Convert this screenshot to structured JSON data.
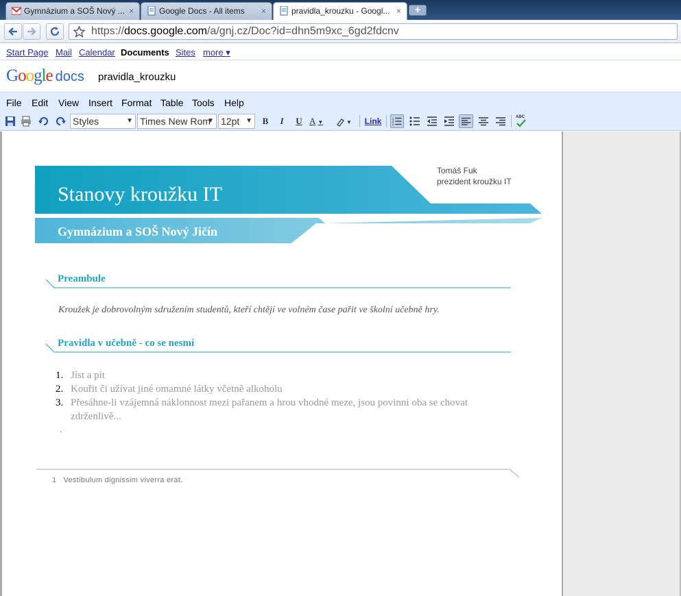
{
  "browser": {
    "tabs": [
      {
        "title": "Gymnázium a SOŠ Nový ...",
        "icon": "gmail-icon",
        "active": false
      },
      {
        "title": "Google Docs - All items",
        "icon": "docs-icon",
        "active": false
      },
      {
        "title": "pravidla_krouzku - Googl...",
        "icon": "docs-icon",
        "active": true
      }
    ],
    "close_glyph": "×",
    "new_tab_glyph": "+",
    "url_prefix": "https://",
    "url_host": "docs.google.com",
    "url_path": "/a/gnj.cz/Doc?id=dhn5m9xc_6gd2fdcnv"
  },
  "gbar": {
    "links": [
      "Start Page",
      "Mail",
      "Calendar",
      "Documents",
      "Sites",
      "more ▾"
    ],
    "current": "Documents"
  },
  "header": {
    "logo_text": "Google",
    "logo_product": "docs",
    "doc_title": "pravidla_krouzku"
  },
  "menu": [
    "File",
    "Edit",
    "View",
    "Insert",
    "Format",
    "Table",
    "Tools",
    "Help"
  ],
  "toolbar": {
    "styles_value": "Styles",
    "font_value": "Times New Rom",
    "size_value": "12pt",
    "bold": "B",
    "italic": "I",
    "underline": "U",
    "text_color": "A",
    "link": "Link",
    "spell": "ABC"
  },
  "document": {
    "author_name": "Tomáš Fuk",
    "author_role": "prezident kroužku IT",
    "title": "Stanovy kroužku IT",
    "subtitle": "Gymnázium a SOŠ Nový Jičín",
    "section1": "Preambule",
    "paragraph": "Kroužek je dobrovolným sdružením studentů, kteří chtějí ve volném čase pařit ve školní učebně hry.",
    "section2": "Pravidla v učebně - co se nesmí",
    "rules": [
      {
        "num": "1.",
        "text": "Jíst a pít"
      },
      {
        "num": "2.",
        "text": "Kouřit či užívat jiné omamné látky včetně alkoholu"
      },
      {
        "num": "3.",
        "text": "Přesáhne-li vzájemná náklonnost mezi pařanem a hrou vhodné meze, jsou povinni oba se chovat zdrženlivě..."
      }
    ],
    "trailing_dot": ".",
    "footnote_num": "1",
    "footnote_text": "Vestibulum dignissim viverra erat."
  },
  "colors": {
    "banner_dark": "#17a3c1",
    "banner_light": "#5bbcd9",
    "accent": "#1ea7c4",
    "link": "#2a2ab0"
  }
}
